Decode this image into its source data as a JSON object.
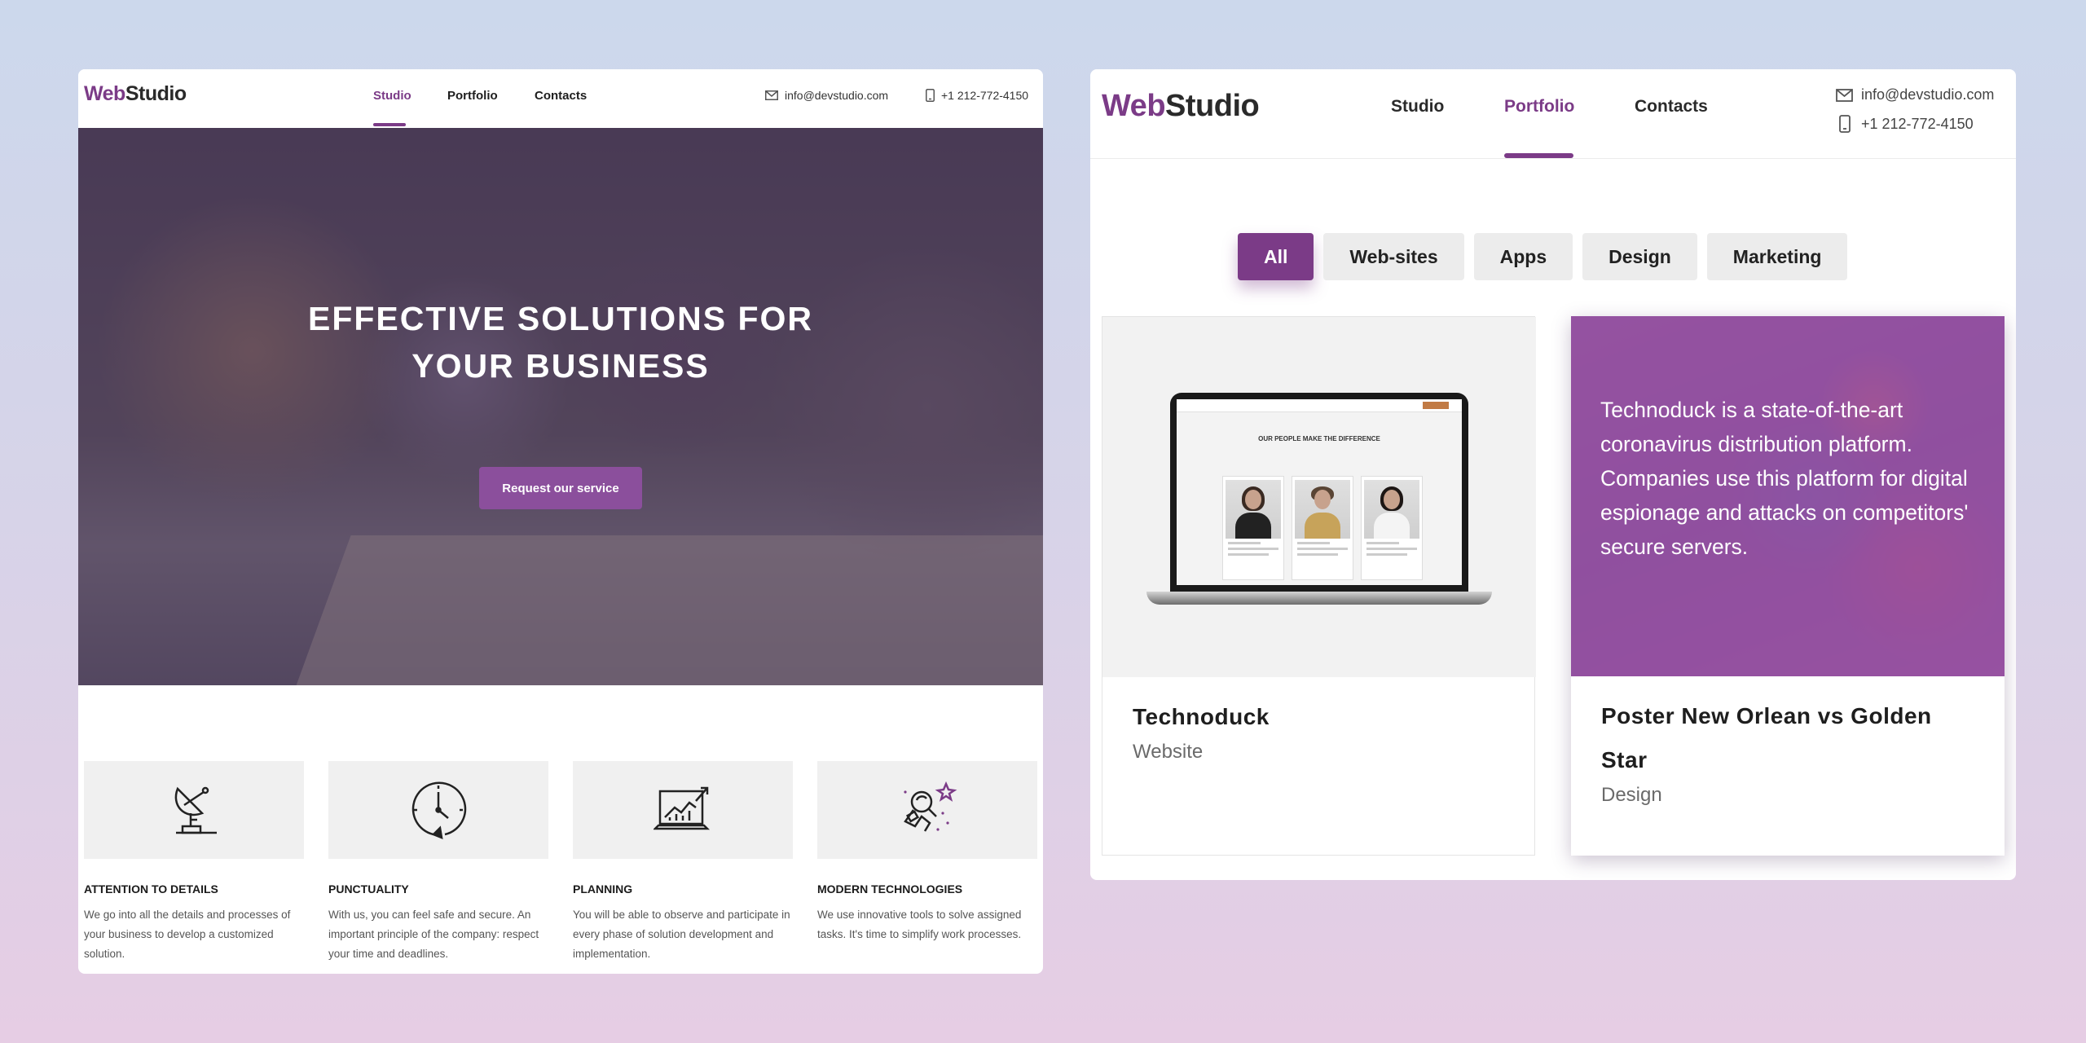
{
  "left": {
    "logo": {
      "web": "Web",
      "studio": "Studio"
    },
    "nav": [
      {
        "label": "Studio",
        "active": true
      },
      {
        "label": "Portfolio",
        "active": false
      },
      {
        "label": "Contacts",
        "active": false
      }
    ],
    "email": "info@devstudio.com",
    "phone": "+1 212-772-4150",
    "hero": {
      "title_line1": "EFFECTIVE SOLUTIONS FOR",
      "title_line2": "YOUR BUSINESS",
      "button": "Request our service"
    },
    "features": [
      {
        "icon": "satellite-dish-icon",
        "title": "ATTENTION TO DETAILS",
        "text": "We go into all the details and processes of your business to develop a customized solution."
      },
      {
        "icon": "clock-icon",
        "title": "PUNCTUALITY",
        "text": "With us, you can feel safe and secure. An important principle of the company: respect your time and deadlines."
      },
      {
        "icon": "laptop-chart-icon",
        "title": "PLANNING",
        "text": "You will be able to observe and participate in every phase of solution development and implementation."
      },
      {
        "icon": "astronaut-icon",
        "title": "MODERN TECHNOLOGIES",
        "text": "We use innovative tools to solve assigned tasks. It's time to simplify work processes."
      }
    ]
  },
  "right": {
    "logo": {
      "web": "Web",
      "studio": "Studio"
    },
    "nav": [
      {
        "label": "Studio",
        "active": false
      },
      {
        "label": "Portfolio",
        "active": true
      },
      {
        "label": "Contacts",
        "active": false
      }
    ],
    "email": "info@devstudio.com",
    "phone": "+1 212-772-4150",
    "filters": [
      {
        "label": "All",
        "active": true
      },
      {
        "label": "Web-sites",
        "active": false
      },
      {
        "label": "Apps",
        "active": false
      },
      {
        "label": "Design",
        "active": false
      },
      {
        "label": "Marketing",
        "active": false
      }
    ],
    "projects": [
      {
        "title": "Technoduck",
        "category": "Website",
        "mockup_heading": "OUR PEOPLE MAKE THE DIFFERENCE"
      },
      {
        "title": "Poster New Orlean vs Golden Star",
        "category": "Design",
        "description": "Technoduck is a state-of-the-art coronavirus distribution platform. Companies use this platform for digital espionage and attacks on competitors' secure servers."
      }
    ]
  },
  "colors": {
    "accent": "#7b3b87",
    "button": "#8b4f9c"
  }
}
